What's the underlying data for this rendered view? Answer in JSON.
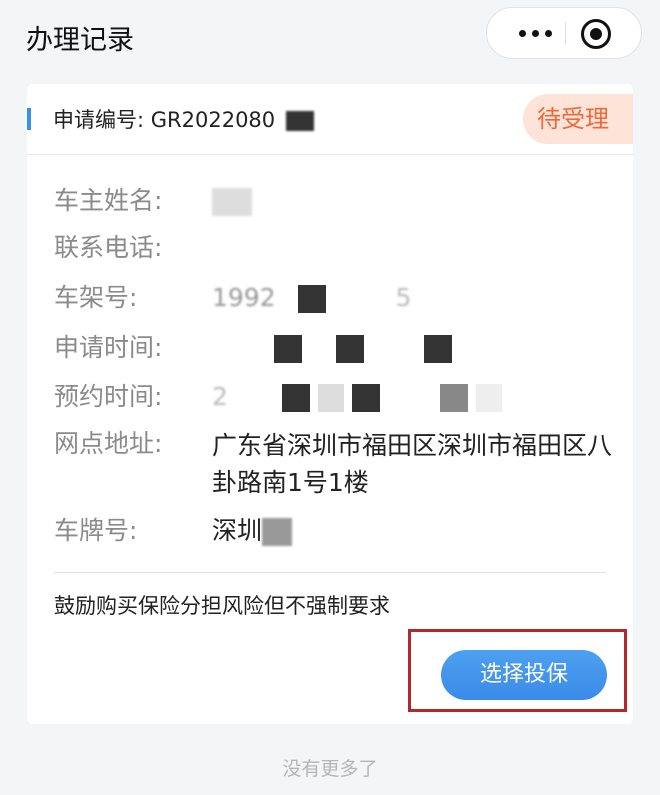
{
  "header": {
    "title": "办理记录"
  },
  "record": {
    "app_no_label": "申请编号:",
    "app_no_value": "GR2022080",
    "status": "待受理",
    "fields": [
      {
        "label": "车主姓名:",
        "value": ""
      },
      {
        "label": "联系电话:",
        "value": ""
      },
      {
        "label": "车架号:",
        "value": "1992",
        "value_suffix": "5"
      },
      {
        "label": "申请时间:",
        "value": ""
      },
      {
        "label": "预约时间:",
        "value": "2"
      },
      {
        "label": "网点地址:",
        "value": "广东省深圳市福田区深圳市福田区八卦路南1号1楼"
      },
      {
        "label": "车牌号:",
        "value": "深圳"
      }
    ],
    "note": "鼓励购买保险分担风险但不强制要求",
    "action_label": "选择投保"
  },
  "footer": {
    "text": "没有更多了"
  },
  "colors": {
    "accent": "#3d8fea",
    "status_bg": "#fde3d8",
    "status_text": "#ec6a3a",
    "highlight_box": "#b2282c"
  }
}
